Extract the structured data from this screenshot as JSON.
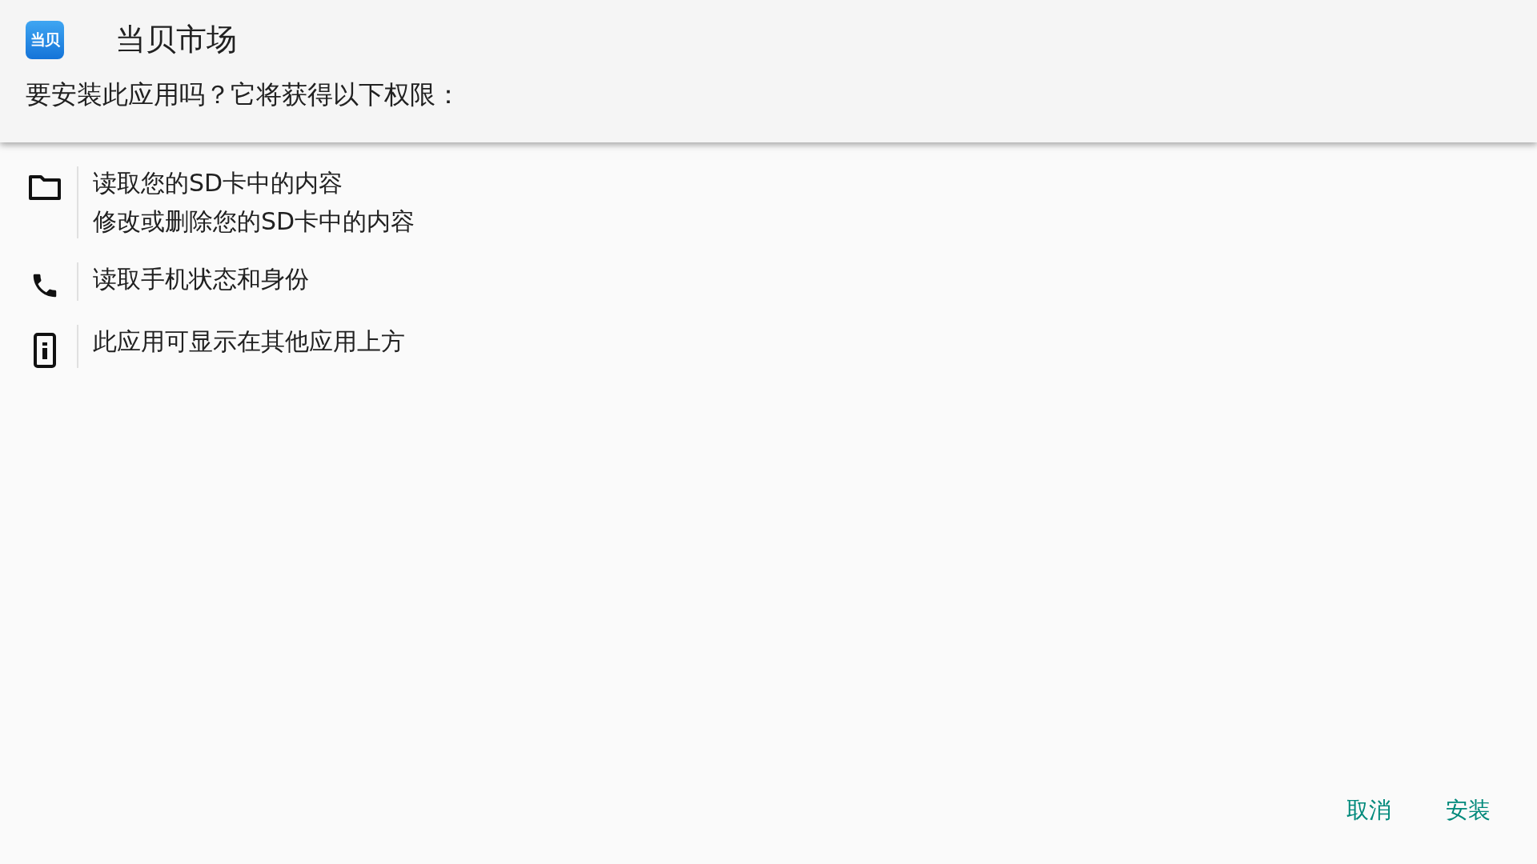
{
  "header": {
    "app_icon_label": "当贝",
    "app_name": "当贝市场",
    "prompt": "要安装此应用吗？它将获得以下权限："
  },
  "permissions": [
    {
      "kind": "storage",
      "lines": [
        "读取您的SD卡中的内容",
        "修改或删除您的SD卡中的内容"
      ]
    },
    {
      "kind": "phone",
      "lines": [
        "读取手机状态和身份"
      ]
    },
    {
      "kind": "overlay",
      "lines": [
        "此应用可显示在其他应用上方"
      ]
    }
  ],
  "buttons": [
    "取消",
    "安装"
  ]
}
